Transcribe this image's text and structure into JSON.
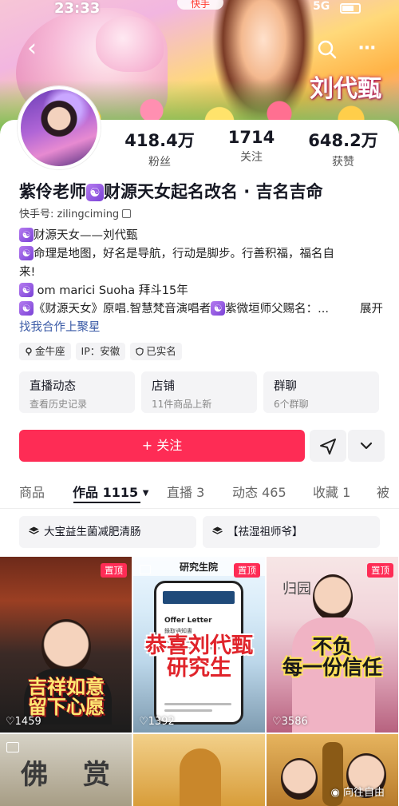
{
  "status_bar": {
    "time": "23:33",
    "app": "快手",
    "network": "5G"
  },
  "banner": {
    "name_art": "刘代甄"
  },
  "profile": {
    "name": "紫伶老师",
    "name_suffix": "财源天女起名改名 · 吉名吉命",
    "user_id": "快手号: zilingciming",
    "stats": [
      {
        "num": "418.4万",
        "label": "粉丝"
      },
      {
        "num": "1714",
        "label": "关注"
      },
      {
        "num": "648.2万",
        "label": "获赞"
      }
    ],
    "bio": {
      "line1": "财源天女——刘代甄",
      "line2": "命理是地图，好名是导航，行动是脚步。行善积福，福名自",
      "line3": "来!",
      "line4": "om marici  Suoha 拜斗15年",
      "line5a": "《财源天女》原唱.智慧梵音演唱者",
      "line5b": "紫微垣师父赐名：...",
      "expand": "展开",
      "link": "找我合作上聚星"
    },
    "chips": [
      "金牛座",
      "IP：安徽",
      "已实名"
    ],
    "tiles": [
      {
        "title": "直播动态",
        "sub": "查看历史记录"
      },
      {
        "title": "店铺",
        "sub": "11件商品上新"
      },
      {
        "title": "群聊",
        "sub": "6个群聊"
      }
    ],
    "follow_label": "+ 关注"
  },
  "tabs": [
    {
      "label": "商品",
      "count": ""
    },
    {
      "label": "作品",
      "count": "1115"
    },
    {
      "label": "直播",
      "count": "3"
    },
    {
      "label": "动态",
      "count": "465"
    },
    {
      "label": "收藏",
      "count": "1"
    },
    {
      "label": "被",
      "count": ""
    }
  ],
  "collections": [
    "大宝益生菌减肥清肠",
    "【祛湿祖师爷】"
  ],
  "videos": [
    {
      "pinned": "置顶",
      "likes": "1459",
      "caption": "吉祥如意\n留下心愿"
    },
    {
      "pinned": "置顶",
      "likes": "1392",
      "caption": "恭喜刘代甄\n研究生",
      "header": "研究生院",
      "doc_title": "Offer Letter",
      "doc_sub": "錄取通知書"
    },
    {
      "pinned": "置顶",
      "likes": "3586",
      "caption": "不负\n每一份信任",
      "sign": "归园"
    },
    {
      "caption": "佛 赏"
    },
    {},
    {}
  ],
  "watermark": "向往自由",
  "colors": {
    "accent": "#fe2c55",
    "link": "#3a5aa6"
  }
}
